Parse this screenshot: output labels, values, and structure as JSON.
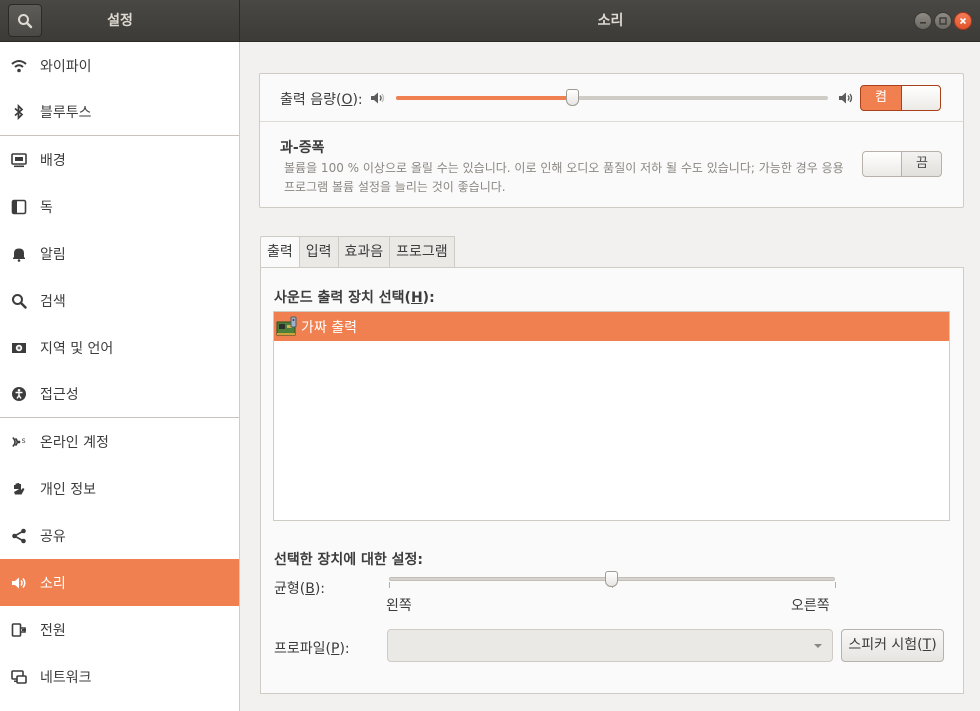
{
  "header": {
    "sidebar_title": "설정",
    "title": "소리",
    "search_icon": "search-icon",
    "window_controls": [
      "minimize-icon",
      "maximize-icon",
      "close-icon"
    ]
  },
  "sidebar": {
    "items": [
      {
        "label": "와이파이",
        "icon": "wifi-icon"
      },
      {
        "label": "블루투스",
        "icon": "bluetooth-icon"
      },
      {
        "label": "배경",
        "icon": "background-icon"
      },
      {
        "label": "독",
        "icon": "dock-icon"
      },
      {
        "label": "알림",
        "icon": "bell-icon"
      },
      {
        "label": "검색",
        "icon": "search-icon"
      },
      {
        "label": "지역 및 언어",
        "icon": "region-icon"
      },
      {
        "label": "접근성",
        "icon": "accessibility-icon"
      },
      {
        "label": "온라인 계정",
        "icon": "online-accounts-icon"
      },
      {
        "label": "개인 정보",
        "icon": "privacy-hand-icon"
      },
      {
        "label": "공유",
        "icon": "share-icon"
      },
      {
        "label": "소리",
        "icon": "speaker-icon",
        "active": true
      },
      {
        "label": "전원",
        "icon": "power-icon"
      },
      {
        "label": "네트워크",
        "icon": "network-icon"
      }
    ]
  },
  "volume": {
    "label_pre": "출력 음량(",
    "label_key": "O",
    "label_post": "):",
    "level": 0.41,
    "switch_label": "켬",
    "switch_on": true
  },
  "amplification": {
    "title": "과-증폭",
    "description": "볼륨을 100 % 이상으로 올릴 수는 있습니다. 이로 인해 오디오 품질이 저하 될 수도 있습니다; 가능한 경우 응용 프로그램 볼륨 설정을 늘리는 것이 좋습니다.",
    "switch_label": "끔",
    "switch_on": false
  },
  "tabs": [
    "출력",
    "입력",
    "효과음",
    "프로그램"
  ],
  "output": {
    "device_section_pre": "사운드 출력 장치 선택(",
    "device_section_key": "H",
    "device_section_post": "):",
    "devices": [
      {
        "name": "가짜 출력",
        "icon": "sound-card-icon",
        "selected": true
      }
    ],
    "settings_title": "선택한 장치에 대한 설정:",
    "balance_pre": "균형(",
    "balance_key": "B",
    "balance_post": "):",
    "balance_value": 0.5,
    "balance_left": "왼쪽",
    "balance_right": "오른쪽",
    "profile_pre": "프로파일(",
    "profile_key": "P",
    "profile_post": "):",
    "profile_value": "",
    "test_pre": "스피커 시험(",
    "test_key": "T",
    "test_post": ")"
  }
}
